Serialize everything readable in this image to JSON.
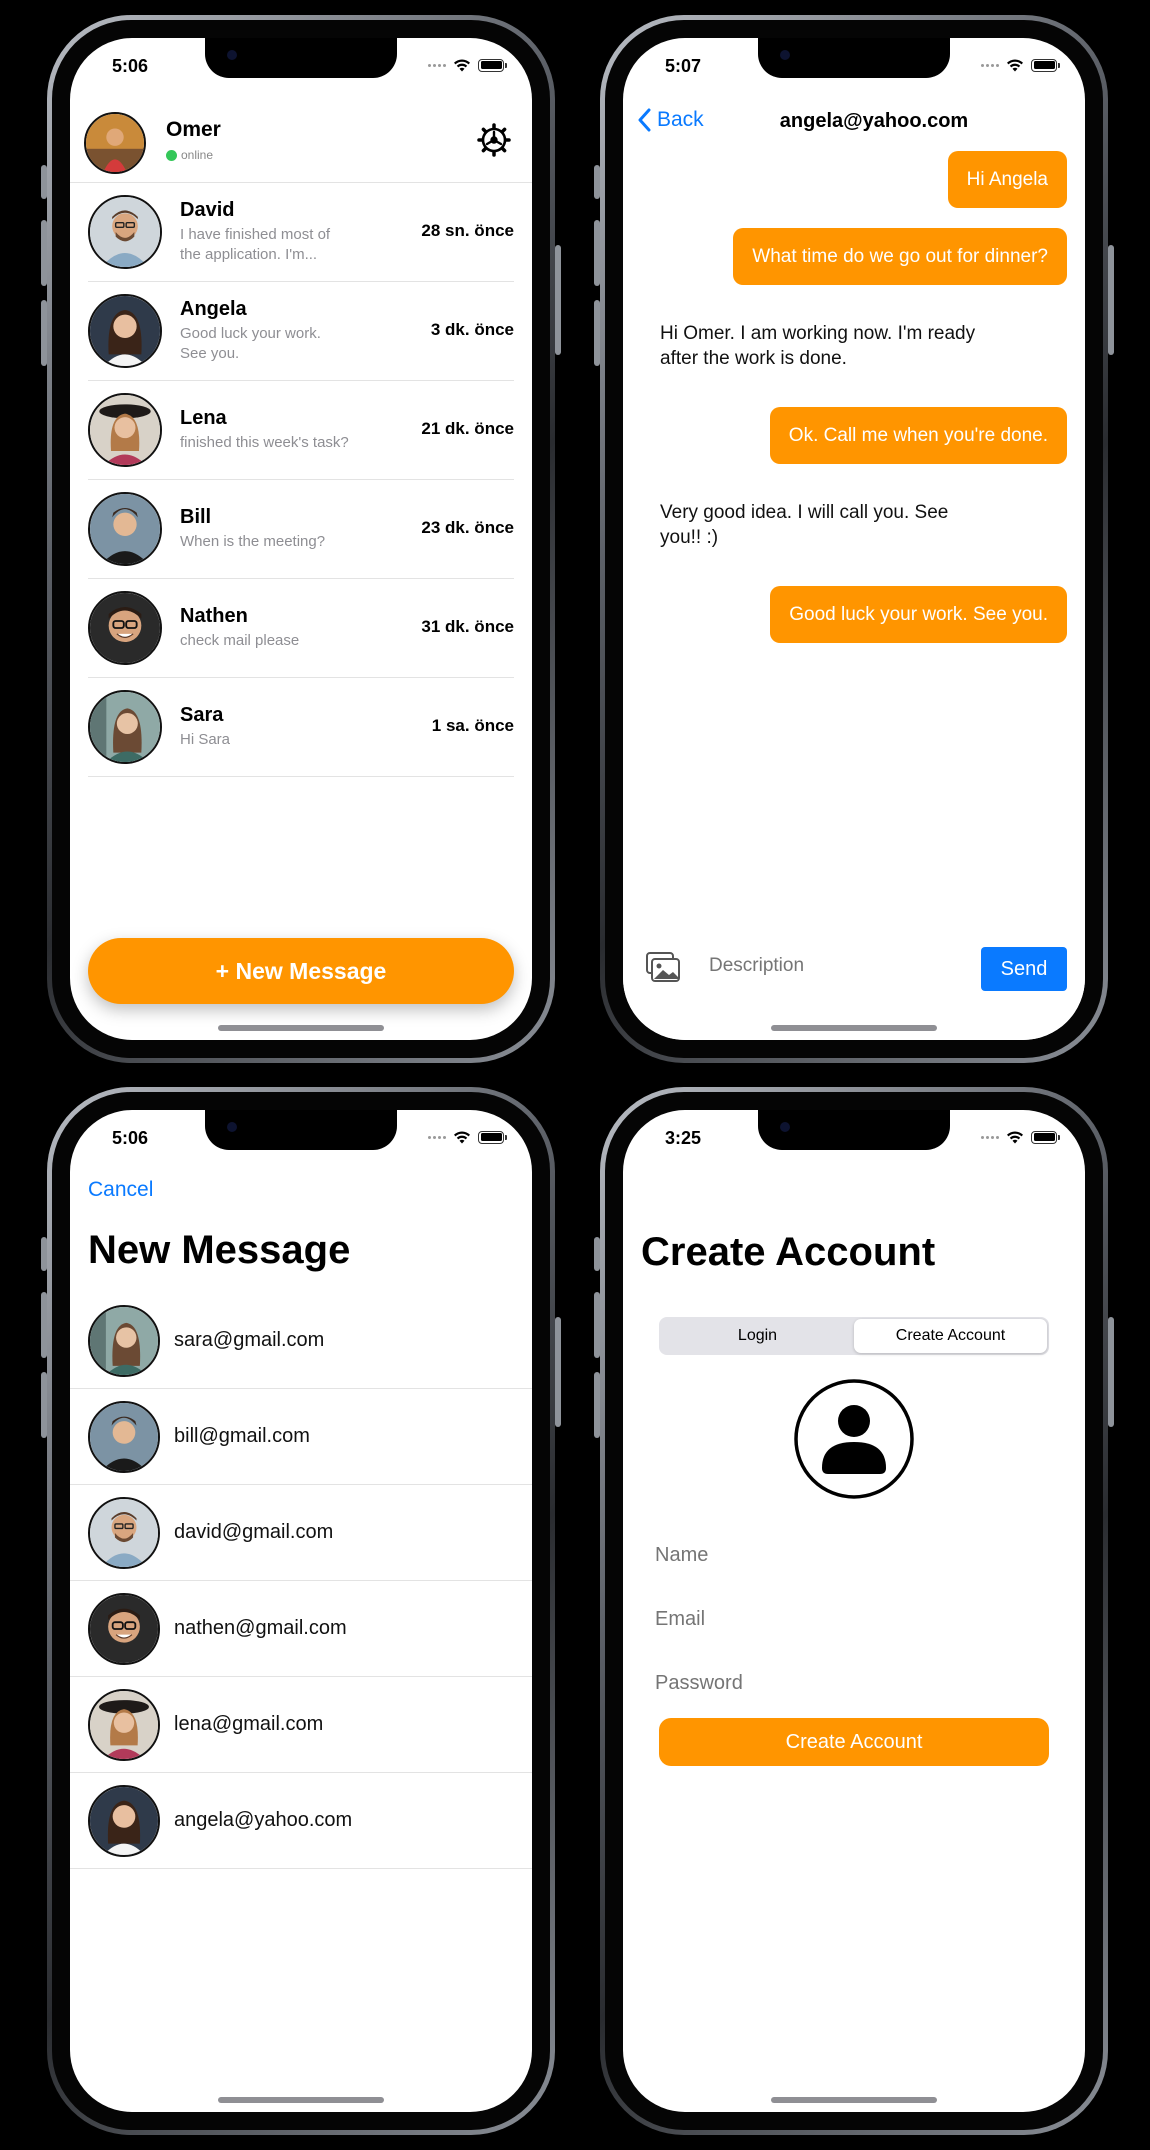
{
  "screens": {
    "chats": {
      "status_time": "5:06",
      "user": {
        "name": "Omer",
        "status": "online"
      },
      "chats": [
        {
          "name": "David",
          "message": "I have finished most of the application. I'm...",
          "time": "28 sn. önce"
        },
        {
          "name": "Angela",
          "message": "Good luck your work. See you.",
          "time": "3 dk. önce"
        },
        {
          "name": "Lena",
          "message": "finished this week's task?",
          "time": "21 dk. önce"
        },
        {
          "name": "Bill",
          "message": "When is the meeting?",
          "time": "23 dk. önce"
        },
        {
          "name": "Nathen",
          "message": "check mail please",
          "time": "31 dk. önce"
        },
        {
          "name": "Sara",
          "message": "Hi Sara",
          "time": "1 sa. önce"
        }
      ],
      "new_message_label": "+ New Message"
    },
    "conversation": {
      "status_time": "5:07",
      "back_label": "Back",
      "title": "angela@yahoo.com",
      "messages": [
        {
          "from": "me",
          "text": "Hi Angela"
        },
        {
          "from": "me",
          "text": "What time do we go out for dinner?"
        },
        {
          "from": "them",
          "text": "Hi Omer. I am working now. I'm ready after the work is done."
        },
        {
          "from": "me",
          "text": "Ok. Call me when you're done."
        },
        {
          "from": "them",
          "text": "Very good idea. I will call you. See you!! :)"
        },
        {
          "from": "me",
          "text": "Good luck your work. See you."
        }
      ],
      "input_placeholder": "Description",
      "send_label": "Send"
    },
    "new_message": {
      "status_time": "5:06",
      "cancel_label": "Cancel",
      "title": "New Message",
      "contacts": [
        {
          "email": "sara@gmail.com"
        },
        {
          "email": "bill@gmail.com"
        },
        {
          "email": "david@gmail.com"
        },
        {
          "email": "nathen@gmail.com"
        },
        {
          "email": "lena@gmail.com"
        },
        {
          "email": "angela@yahoo.com"
        }
      ]
    },
    "create_account": {
      "status_time": "3:25",
      "title": "Create Account",
      "segments": [
        "Login",
        "Create Account"
      ],
      "selected_segment": "Create Account",
      "fields": [
        {
          "placeholder": "Name"
        },
        {
          "placeholder": "Email"
        },
        {
          "placeholder": "Password"
        }
      ],
      "submit_label": "Create Account"
    }
  },
  "colors": {
    "accent_orange": "#ff9500",
    "link_blue": "#0a7aff",
    "online_green": "#34c759",
    "chat_background": "#f2f2f2"
  },
  "icons": {
    "settings": "gear-icon",
    "back": "chevron-left-icon",
    "attach_image": "photo-gallery-icon",
    "profile": "person-circle-icon"
  }
}
